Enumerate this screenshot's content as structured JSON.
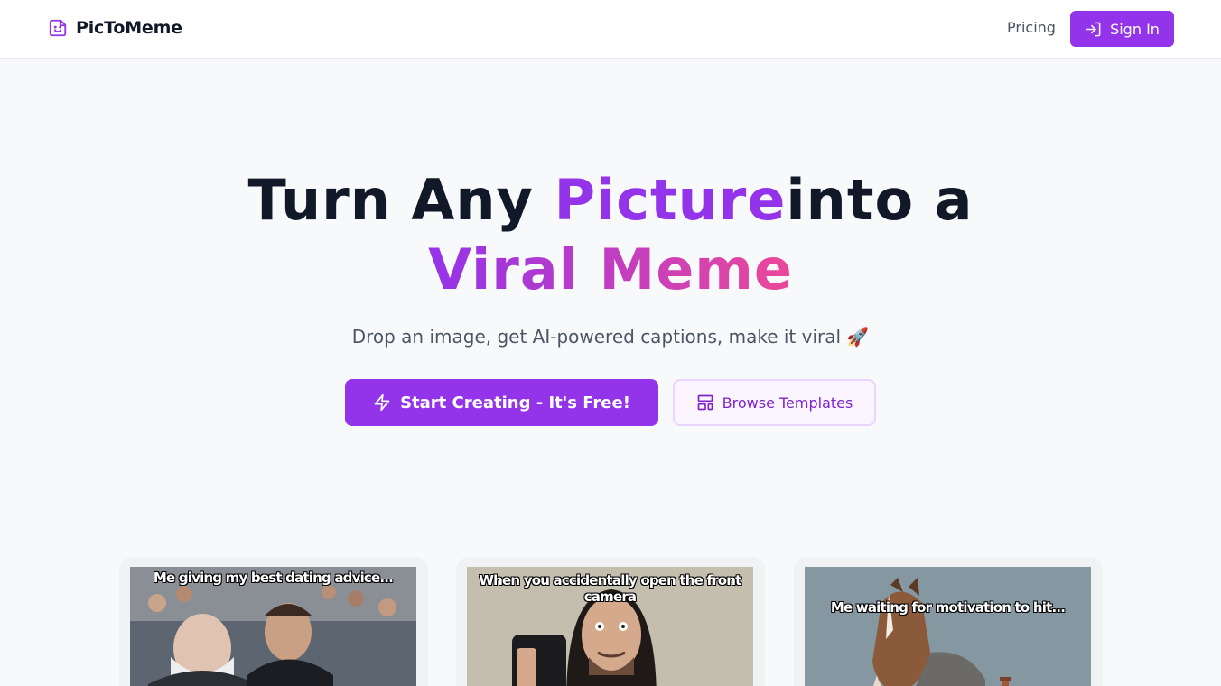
{
  "brand": {
    "name": "PicToMeme"
  },
  "nav": {
    "pricing": "Pricing",
    "sign_in": "Sign In"
  },
  "hero": {
    "title_part1": "Turn Any ",
    "title_highlight": "Picture",
    "title_part2": "into a",
    "title_line2": "Viral Meme",
    "subtitle": "Drop an image, get AI-powered captions, make it viral 🚀",
    "primary_cta": "Start Creating - It's Free!",
    "secondary_cta": "Browse Templates"
  },
  "memes": [
    {
      "caption": "Me giving my best dating advice..."
    },
    {
      "caption": "When you accidentally open the front camera"
    },
    {
      "caption": "Me waiting for motivation to hit..."
    }
  ],
  "colors": {
    "accent": "#9333ea",
    "accent_pink": "#ec4899",
    "background": "#f8f9fb"
  },
  "icons": {
    "brand": "sticker-smile-icon",
    "sign_in": "log-in-icon",
    "primary_cta": "zap-icon",
    "secondary_cta": "layout-template-icon"
  }
}
